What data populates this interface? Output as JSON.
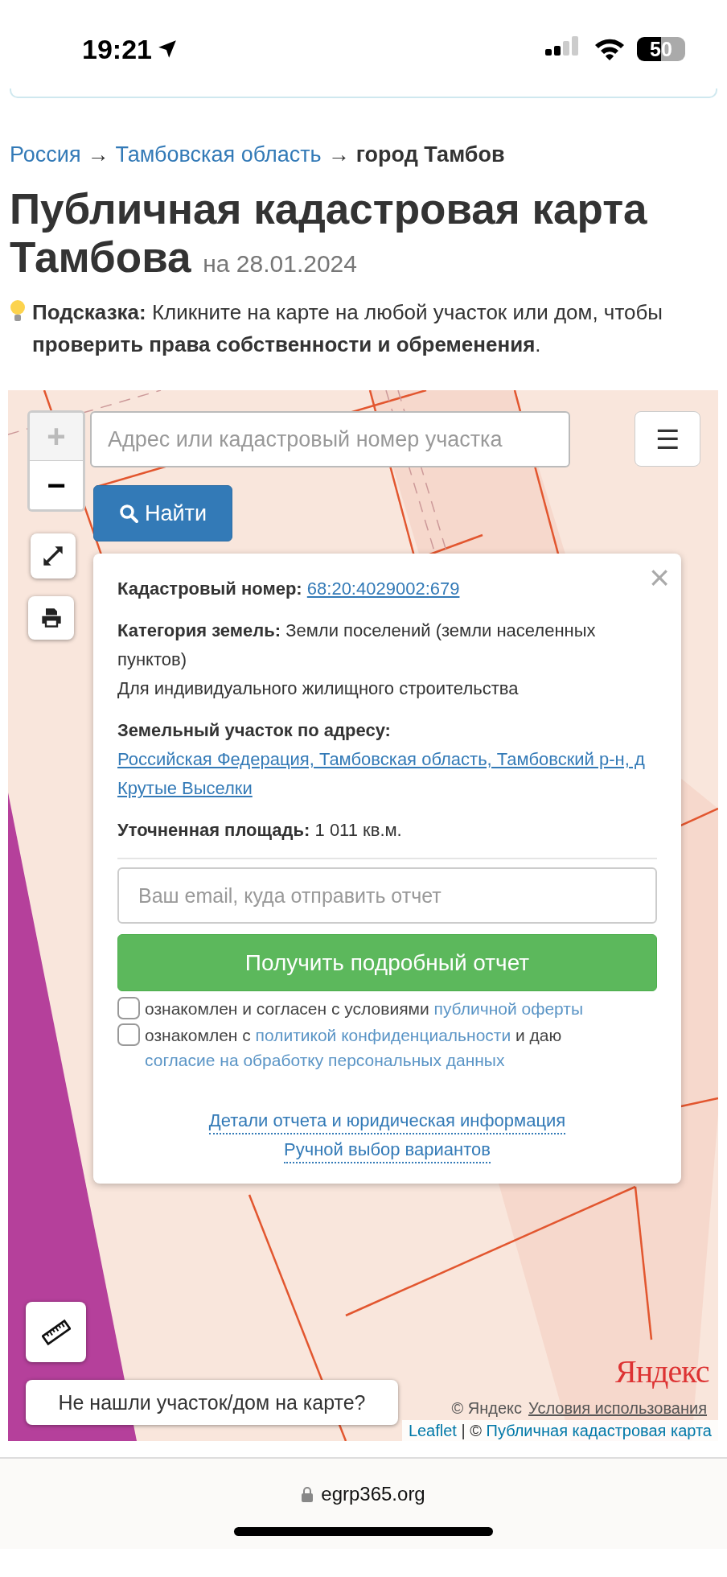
{
  "status_bar": {
    "time": "19:21",
    "battery": "50"
  },
  "breadcrumb": [
    {
      "label": "Россия",
      "kind": "link"
    },
    {
      "label": "→",
      "kind": "arrow"
    },
    {
      "label": "Тамбовская область",
      "kind": "link"
    },
    {
      "label": "→",
      "kind": "arrow"
    },
    {
      "label": "город Тамбов",
      "kind": "current"
    }
  ],
  "title": {
    "text": "Публичная кадастровая карта Тамбова",
    "date": "на 28.01.2024"
  },
  "hint": "**Подсказка:** Кликните на карте на любой участок или дом, чтобы **проверить права собственности и обременения**.",
  "map": {
    "search": {
      "placeholder": "Адрес или кадастровый номер участка"
    },
    "zoom_in": "+",
    "zoom_out": "−",
    "menu": "☰",
    "find_button": "Найти",
    "popup": {
      "close": "×",
      "fields": [
        {
          "label": "Кадастровый номер:",
          "value": "68:20:4029002:679",
          "kind": "link"
        },
        {
          "label": "Категория земель:",
          "value": "Земли поселений (земли населенных пунктов)",
          "kind": "text"
        },
        {
          "value": "Для индивидуального жилищного строительства",
          "kind": "plain"
        },
        {
          "label": "Земельный участок по адресу:",
          "value": "Российская Федерация, Тамбовская область, Тамбовский р-н, д Крутые Выселки",
          "kind": "link"
        },
        {
          "label": "Уточненная площадь:",
          "value": "1 011 кв.м.",
          "kind": "text"
        }
      ],
      "email": {
        "placeholder": "Ваш email, куда отправить отчет"
      },
      "submit": "Получить подробный отчет",
      "consents": [
        {
          "checked": false,
          "parts": [
            {
              "text": "ознакомлен и согласен с условиями ",
              "kind": "text"
            },
            {
              "text": "публичной оферты",
              "kind": "link"
            }
          ]
        },
        {
          "checked": false,
          "parts": [
            {
              "text": "ознакомлен с ",
              "kind": "text"
            },
            {
              "text": "политикой конфиденциальности",
              "kind": "link"
            },
            {
              "text": " и даю ",
              "kind": "text"
            },
            {
              "text": "согласие на обработку персональных данных",
              "kind": "link"
            }
          ]
        }
      ],
      "links": [
        "Детали отчета и юридическая информация",
        "Ручной выбор вариантов"
      ]
    },
    "not_found_button": "Не нашли участок/дом на карте?",
    "logo": "Яндекс",
    "yandex_attribution": [
      "© Яндекс",
      "Условия использования"
    ],
    "attribution": [
      {
        "text": "Leaflet",
        "kind": "link"
      },
      {
        "text": " | © ",
        "kind": "text"
      },
      {
        "text": "Публичная кадастровая карта",
        "kind": "link"
      }
    ]
  },
  "address_bar": {
    "url": "egrp365.org"
  }
}
